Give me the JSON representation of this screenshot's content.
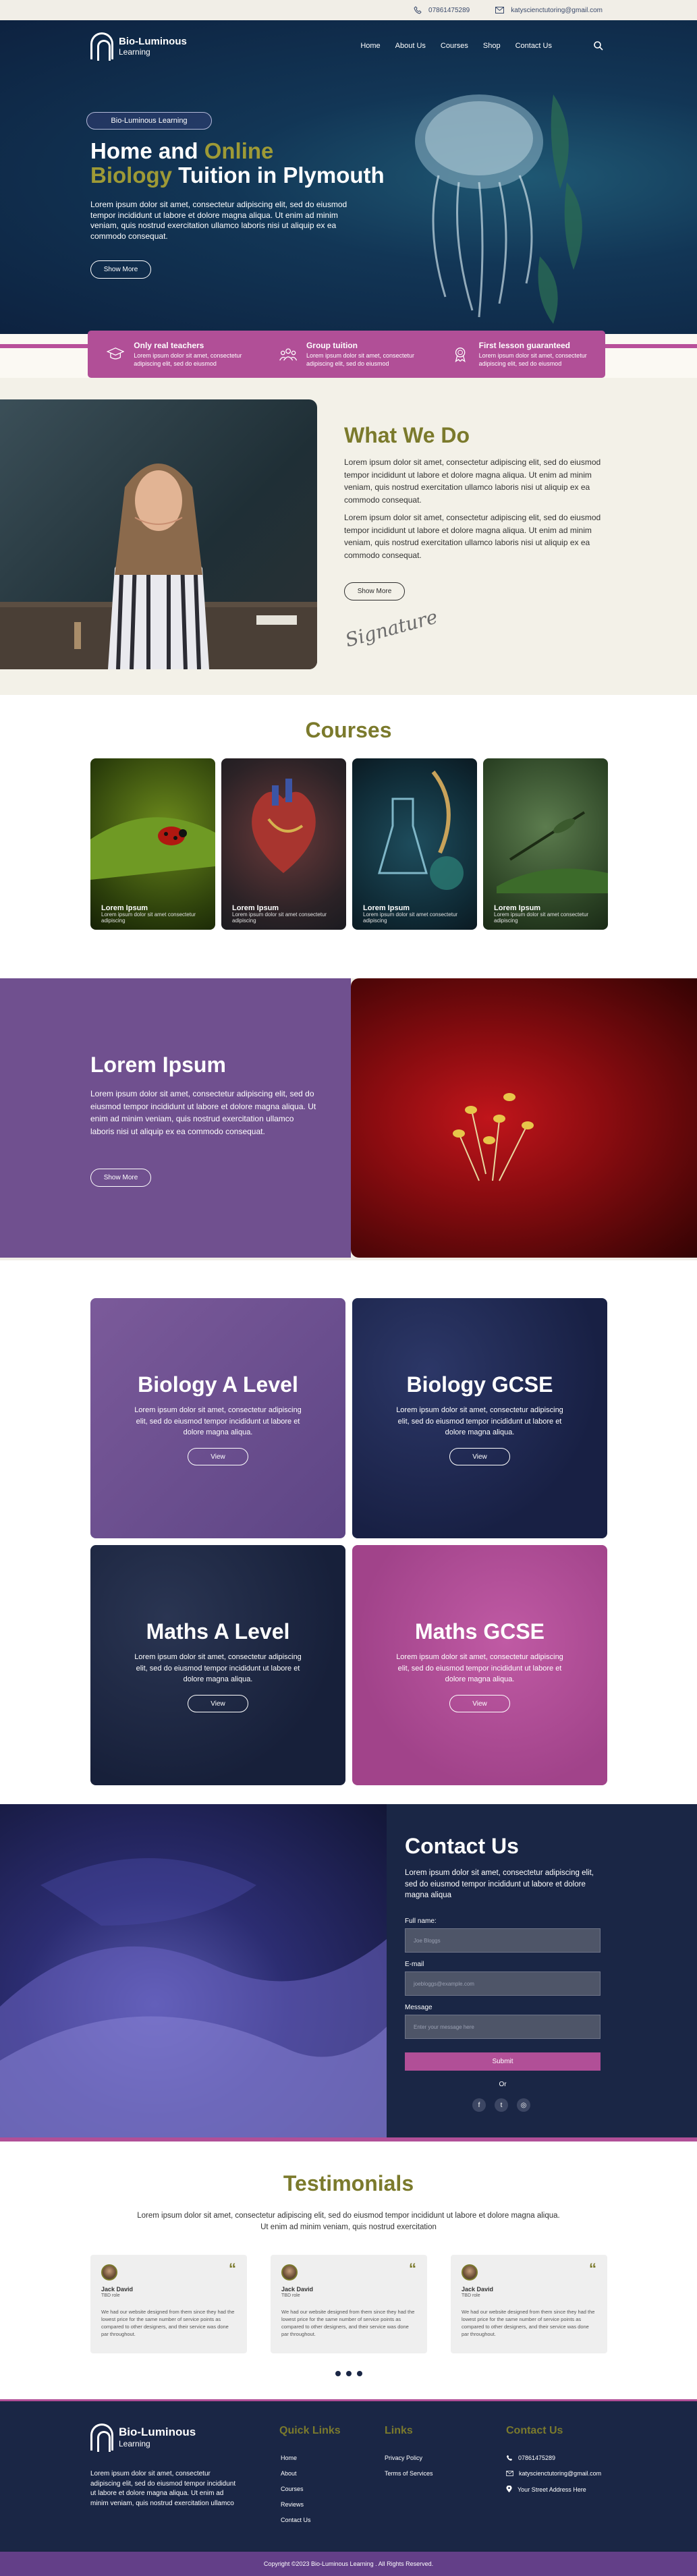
{
  "topbar": {
    "phone": "07861475289",
    "email": "katyscienctutoring@gmail.com"
  },
  "brand": {
    "line1": "Bio-Luminous",
    "line2": "Learning"
  },
  "nav": [
    {
      "label": "Home"
    },
    {
      "label": "About Us"
    },
    {
      "label": "Courses"
    },
    {
      "label": "Shop"
    },
    {
      "label": "Contact Us"
    }
  ],
  "hero": {
    "pill": "Bio-Luminous Learning",
    "title_part1": "Home and ",
    "title_highlight1": "Online",
    "title_highlight2": "Biology",
    "title_part2": " Tuition in Plymouth",
    "lead": "Lorem ipsum dolor sit amet, consectetur adipiscing elit, sed do eiusmod tempor incididunt ut labore et dolore magna aliqua. Ut enim ad minim veniam, quis nostrud exercitation ullamco laboris nisi ut aliquip ex ea commodo consequat.",
    "button": "Show More"
  },
  "features": [
    {
      "icon": "graduation-cap-icon",
      "title": "Only real teachers",
      "text": "Lorem ipsum dolor sit amet, consectetur adipiscing elit, sed do eiusmod"
    },
    {
      "icon": "group-icon",
      "title": "Group tuition",
      "text": "Lorem ipsum dolor sit amet, consectetur adipiscing elit, sed do eiusmod"
    },
    {
      "icon": "award-icon",
      "title": "First lesson guaranteed",
      "text": "Lorem ipsum dolor sit amet, consectetur adipiscing elit, sed do eiusmod"
    }
  ],
  "what_we_do": {
    "title": "What We Do",
    "p1": "Lorem ipsum dolor sit amet, consectetur adipiscing elit, sed do eiusmod tempor incididunt ut labore et dolore magna aliqua. Ut enim ad minim veniam, quis nostrud exercitation ullamco laboris nisi ut aliquip ex ea commodo consequat.",
    "p2": "Lorem ipsum dolor sit amet, consectetur adipiscing elit, sed do eiusmod tempor incididunt ut labore et dolore magna aliqua. Ut enim ad minim veniam, quis nostrud exercitation ullamco laboris nisi ut aliquip ex ea commodo consequat.",
    "button": "Show More",
    "signature": "Signature"
  },
  "courses": {
    "title": "Courses",
    "cards": [
      {
        "title": "Lorem Ipsum",
        "text": "Lorem ipsum dolor sit amet consectetur adipiscing"
      },
      {
        "title": "Lorem Ipsum",
        "text": "Lorem ipsum dolor sit amet consectetur adipiscing"
      },
      {
        "title": "Lorem Ipsum",
        "text": "Lorem ipsum dolor sit amet consectetur adipiscing"
      },
      {
        "title": "Lorem Ipsum",
        "text": "Lorem ipsum dolor sit amet consectetur adipiscing"
      }
    ]
  },
  "split": {
    "title": "Lorem Ipsum",
    "text": "Lorem ipsum dolor sit amet, consectetur adipiscing elit, sed do eiusmod tempor incididunt ut labore et dolore magna aliqua. Ut enim ad minim veniam, quis nostrud exercitation ullamco laboris nisi ut aliquip ex ea commodo consequat.",
    "button": "Show More"
  },
  "subjects": [
    {
      "title": "Biology A Level",
      "text": "Lorem ipsum dolor sit amet, consectetur adipiscing elit, sed do eiusmod tempor incididunt ut labore et dolore magna aliqua.",
      "button": "View"
    },
    {
      "title": "Biology GCSE",
      "text": "Lorem ipsum dolor sit amet, consectetur adipiscing elit, sed do eiusmod tempor incididunt ut labore et dolore magna aliqua.",
      "button": "View"
    },
    {
      "title": "Maths A Level",
      "text": "Lorem ipsum dolor sit amet, consectetur adipiscing elit, sed do eiusmod tempor incididunt ut labore et dolore magna aliqua.",
      "button": "View"
    },
    {
      "title": "Maths GCSE",
      "text": "Lorem ipsum dolor sit amet, consectetur adipiscing elit, sed do eiusmod tempor incididunt ut labore et dolore magna aliqua.",
      "button": "View"
    }
  ],
  "contact": {
    "title": "Contact Us",
    "text": "Lorem ipsum dolor sit amet, consectetur adipiscing elit, sed do eiusmod tempor incididunt ut labore et dolore magna aliqua",
    "name_label": "Full name:",
    "name_placeholder": "Joe Bloggs",
    "email_label": "E-mail",
    "email_placeholder": "joebloggs@example.com",
    "message_label": "Message",
    "message_placeholder": "Enter your message here",
    "submit": "Submit",
    "or": "Or"
  },
  "testimonials": {
    "title": "Testimonials",
    "text": "Lorem ipsum dolor sit amet, consectetur adipiscing elit, sed do eiusmod tempor incididunt ut labore et dolore magna aliqua. Ut enim ad minim veniam, quis nostrud exercitation",
    "items": [
      {
        "name": "Jack David",
        "role": "TBD role",
        "text": "We had our website designed from them since they had the lowest price for the same number of service points as compared to other designers, and their service was done par throughout."
      },
      {
        "name": "Jack David",
        "role": "TBD role",
        "text": "We had our website designed from them since they had the lowest price for the same number of service points as compared to other designers, and their service was done par throughout."
      },
      {
        "name": "Jack David",
        "role": "TBD role",
        "text": "We had our website designed from them since they had the lowest price for the same number of service points as compared to other designers, and their service was done par throughout."
      }
    ]
  },
  "footer": {
    "about": "Lorem ipsum dolor sit amet, consectetur adipiscing elit, sed do eiusmod tempor incididunt ut labore et dolore magna aliqua. Ut enim ad minim veniam, quis nostrud exercitation ullamco",
    "quick_title": "Quick Links",
    "quick": [
      "Home",
      "About",
      "Courses",
      "Reviews",
      "Contact Us"
    ],
    "links_title": "Links",
    "links": [
      "Privacy Policy",
      "Terms of Services"
    ],
    "contact_title": "Contact Us",
    "phone": "07861475289",
    "email": "katyscienctutoring@gmail.com",
    "address": "Your Street Address Here",
    "copyright": "Copyright ©2023 Bio-Luminous Learning . All Rights Reserved."
  }
}
